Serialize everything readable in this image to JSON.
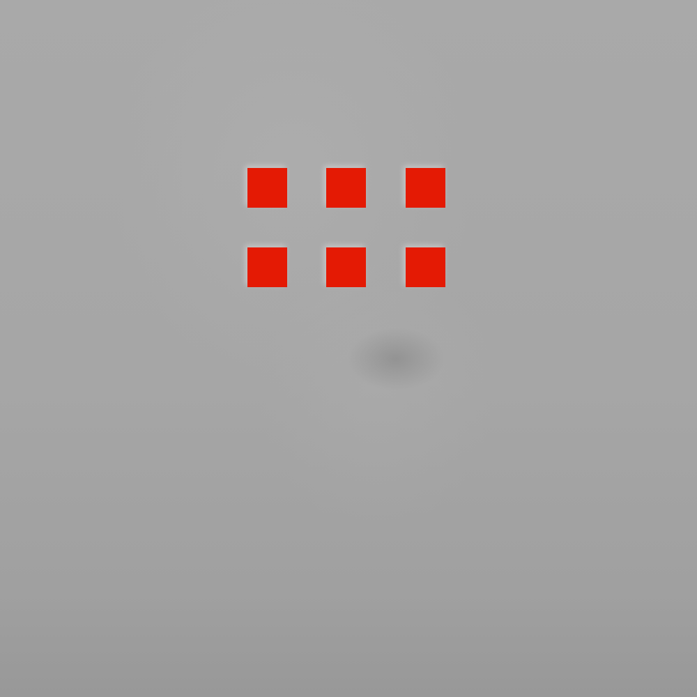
{
  "background": {
    "base_color": "#a3a3a3"
  },
  "grid": {
    "rows": 2,
    "columns": 3,
    "square_color": "#e41a04",
    "squares": [
      {
        "id": "r0c0"
      },
      {
        "id": "r0c1"
      },
      {
        "id": "r0c2"
      },
      {
        "id": "r1c0"
      },
      {
        "id": "r1c1"
      },
      {
        "id": "r1c2"
      }
    ]
  }
}
